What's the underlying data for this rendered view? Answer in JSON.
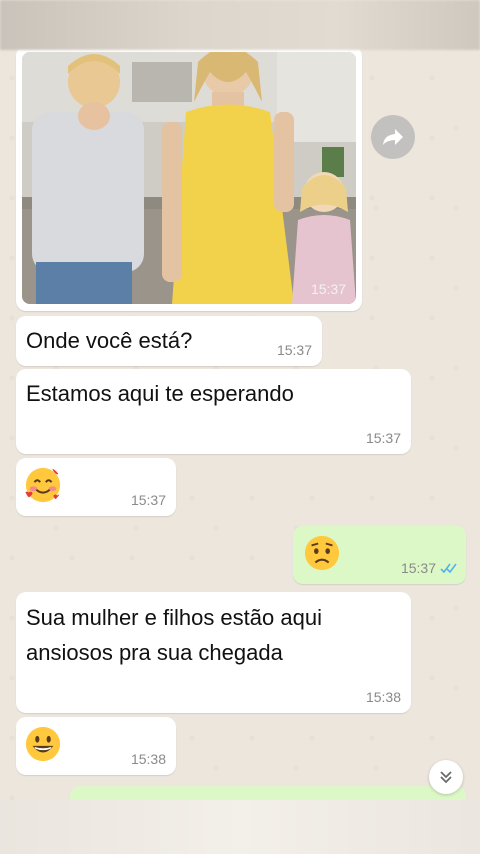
{
  "messages": [
    {
      "type": "image",
      "direction": "incoming",
      "time": "15:37"
    },
    {
      "type": "text",
      "direction": "incoming",
      "text": "Onde você está?",
      "time": "15:37"
    },
    {
      "type": "text",
      "direction": "incoming",
      "text": "Estamos aqui te esperando",
      "time": "15:37"
    },
    {
      "type": "emoji",
      "direction": "incoming",
      "emoji": "smiling-face-with-hearts",
      "time": "15:37"
    },
    {
      "type": "emoji",
      "direction": "outgoing",
      "emoji": "worried-face",
      "time": "15:37",
      "status": "read"
    },
    {
      "type": "text",
      "direction": "incoming",
      "text": "Sua mulher e filhos estão aqui ansiosos pra sua chegada",
      "time": "15:38"
    },
    {
      "type": "emoji",
      "direction": "incoming",
      "emoji": "grinning-face",
      "time": "15:38"
    },
    {
      "type": "text",
      "direction": "outgoing",
      "partially_visible": true
    }
  ],
  "colors": {
    "chat_background": "#ece6dd",
    "incoming_bubble": "#ffffff",
    "outgoing_bubble": "#dcf8c6",
    "read_ticks": "#4fb6ec",
    "timestamp": "#8a8a8a"
  },
  "icons": [
    "forward-icon",
    "double-check-icon",
    "chevron-double-down-icon"
  ]
}
